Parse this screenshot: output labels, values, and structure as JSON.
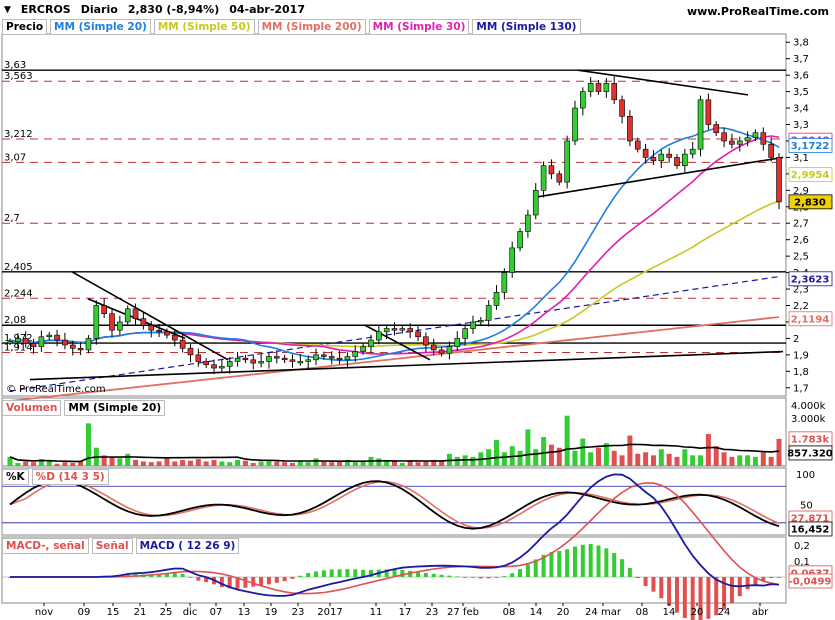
{
  "header": {
    "symbol": "ERCROS",
    "period": "Diario",
    "last_change": "2,830 (-8,94%)",
    "date": "04-abr-2017",
    "site": "www.ProRealTime.com",
    "watermark": "© ProRealTime.com",
    "collapse_icon": "chevron-down-icon"
  },
  "price_panel": {
    "label": "Precio",
    "indicators": [
      {
        "label": "MM (Simple 20)",
        "color": "#1e7fe0"
      },
      {
        "label": "MM (Simple 50)",
        "color": "#cccc33"
      },
      {
        "label": "MM (Simple 200)",
        "color": "#e07060"
      },
      {
        "label": "MM (Simple 30)",
        "color": "#e020b0"
      },
      {
        "label": "MM (Simple 130)",
        "color": "#1a1aa0"
      }
    ],
    "level_labels": [
      "3,63",
      "3,563",
      "3,212",
      "3,07",
      "2,7",
      "2,405",
      "2,244",
      "2,08",
      "1,972",
      "1,914"
    ],
    "value_tags": [
      {
        "text": "3,2048",
        "color": "#e020b0"
      },
      {
        "text": "3,1722",
        "color": "#1e7fe0"
      },
      {
        "text": "2,9954",
        "color": "#c8c820"
      },
      {
        "text": "2,830",
        "color": "#000000",
        "bg": "#f0d000"
      },
      {
        "text": "2,3623",
        "color": "#1a1aa0"
      },
      {
        "text": "2,1194",
        "color": "#e07060"
      }
    ]
  },
  "volume_panel": {
    "label": "Volumen",
    "ma_label": "MM (Simple 20)",
    "axis_labels": [
      "4.000k",
      "3.000k"
    ],
    "value_tags": [
      {
        "text": "1.783k",
        "color": "#e05050"
      },
      {
        "text": "857.320",
        "color": "#000000"
      }
    ]
  },
  "stoch_panel": {
    "label_k": "%K",
    "label_d": "%D (14 3 5)",
    "axis_labels": [
      "100",
      "50"
    ],
    "value_tags": [
      {
        "text": "27,871",
        "color": "#e05050"
      },
      {
        "text": "16,452",
        "color": "#000000"
      }
    ]
  },
  "macd_panel": {
    "label_macd": "MACD-, señal",
    "label_signal": "Señal",
    "label_params": "MACD ( 12 26 9)",
    "axis_labels": [
      "0,2",
      "0,1"
    ],
    "value_tags": [
      {
        "text": "0,0637",
        "color": "#e05050"
      },
      {
        "text": "-0,0499",
        "color": "#e05050"
      }
    ]
  },
  "chart_data": {
    "type": "candlestick",
    "title": "ERCROS",
    "x_labels": [
      "nov",
      "09",
      "15",
      "21",
      "25",
      "dic",
      "07",
      "13",
      "19",
      "23",
      "2017",
      "11",
      "17",
      "23",
      "27 feb",
      "08",
      "14",
      "20",
      "24 mar",
      "08",
      "14",
      "20",
      "24",
      "abr"
    ],
    "y_ticks": [
      "3,8",
      "3,7",
      "3,6",
      "3,5",
      "3,4",
      "3,3",
      "3,2",
      "3,1",
      "3",
      "2,9",
      "2,8",
      "2,7",
      "2,6",
      "2,5",
      "2,4",
      "2,3",
      "2,2",
      "2,1",
      "2",
      "1,9",
      "1,8",
      "1,7"
    ],
    "ylim": [
      1.65,
      3.85
    ],
    "horizontal_levels": [
      3.63,
      3.563,
      3.212,
      3.07,
      2.7,
      2.405,
      2.244,
      2.08,
      1.972,
      1.914
    ],
    "close_series": [
      1.98,
      2.0,
      1.97,
      1.95,
      2.01,
      2.02,
      1.99,
      1.96,
      1.94,
      1.93,
      2.0,
      2.2,
      2.15,
      2.05,
      2.1,
      2.18,
      2.12,
      2.08,
      2.05,
      2.04,
      2.02,
      1.99,
      1.94,
      1.9,
      1.86,
      1.84,
      1.82,
      1.83,
      1.86,
      1.88,
      1.87,
      1.85,
      1.86,
      1.89,
      1.88,
      1.87,
      1.86,
      1.86,
      1.87,
      1.9,
      1.89,
      1.88,
      1.87,
      1.89,
      1.92,
      1.95,
      1.99,
      2.04,
      2.06,
      2.05,
      2.06,
      2.04,
      2.01,
      1.96,
      1.93,
      1.91,
      1.95,
      2.0,
      2.06,
      2.1,
      2.11,
      2.2,
      2.28,
      2.4,
      2.55,
      2.65,
      2.75,
      2.9,
      3.05,
      3.0,
      2.95,
      3.2,
      3.4,
      3.5,
      3.55,
      3.5,
      3.55,
      3.45,
      3.35,
      3.2,
      3.15,
      3.1,
      3.08,
      3.12,
      3.1,
      3.05,
      3.12,
      3.15,
      3.45,
      3.3,
      3.25,
      3.2,
      3.18,
      3.2,
      3.22,
      3.25,
      3.18,
      3.1,
      2.83
    ],
    "volume_k": [
      600,
      200,
      300,
      250,
      450,
      300,
      150,
      250,
      200,
      300,
      2800,
      1200,
      700,
      600,
      500,
      800,
      400,
      300,
      250,
      300,
      500,
      300,
      400,
      350,
      450,
      300,
      400,
      300,
      250,
      400,
      350,
      200,
      300,
      400,
      300,
      250,
      200,
      300,
      250,
      500,
      300,
      250,
      300,
      400,
      350,
      300,
      600,
      500,
      400,
      300,
      200,
      350,
      250,
      300,
      400,
      300,
      800,
      600,
      700,
      600,
      900,
      1100,
      1700,
      900,
      1300,
      1000,
      2400,
      1100,
      1900,
      1400,
      1200,
      3300,
      1000,
      1800,
      900,
      1200,
      1500,
      1000,
      700,
      2000,
      800,
      900,
      700,
      1100,
      800,
      600,
      1100,
      700,
      700,
      2100,
      1300,
      900,
      600,
      700,
      700,
      600,
      900,
      600,
      1783
    ],
    "volume_ma20_k": 857.32,
    "stoch_k_last": 16.452,
    "stoch_d_last": 27.871,
    "macd_last": -0.0499,
    "macd_signal_last": 0.0637
  }
}
